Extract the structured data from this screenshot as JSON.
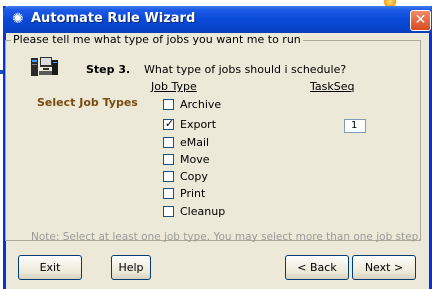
{
  "window": {
    "title": "Automate Rule Wizard",
    "close_glyph": "✕"
  },
  "group": {
    "label": "Please tell me what type of jobs you want me to run"
  },
  "step": {
    "label": "Step 3.",
    "question": "What type of jobs should i schedule?"
  },
  "headers": {
    "job_type": "Job Type",
    "task_seq": "TaskSeq"
  },
  "select_label": "Select Job Types",
  "job_types": [
    {
      "label": "Archive",
      "checked": false
    },
    {
      "label": "Export",
      "checked": true
    },
    {
      "label": "eMail",
      "checked": false
    },
    {
      "label": "Move",
      "checked": false
    },
    {
      "label": "Copy",
      "checked": false
    },
    {
      "label": "Print",
      "checked": false
    },
    {
      "label": "Cleanup",
      "checked": false
    }
  ],
  "taskseq_value": "1",
  "note": "Note: Select at least one job type. You may select more than one job step.",
  "buttons": {
    "exit": "Exit",
    "help": "Help",
    "back": "< Back",
    "next": "Next >"
  },
  "icons": {
    "title": "gear-icon",
    "wizard": "server-computer-icon"
  },
  "colors": {
    "title_bar": "#0a48d8",
    "dialog_bg": "#ece9d8",
    "select_label": "#7a4a10",
    "note_text": "#9a9a9a"
  }
}
